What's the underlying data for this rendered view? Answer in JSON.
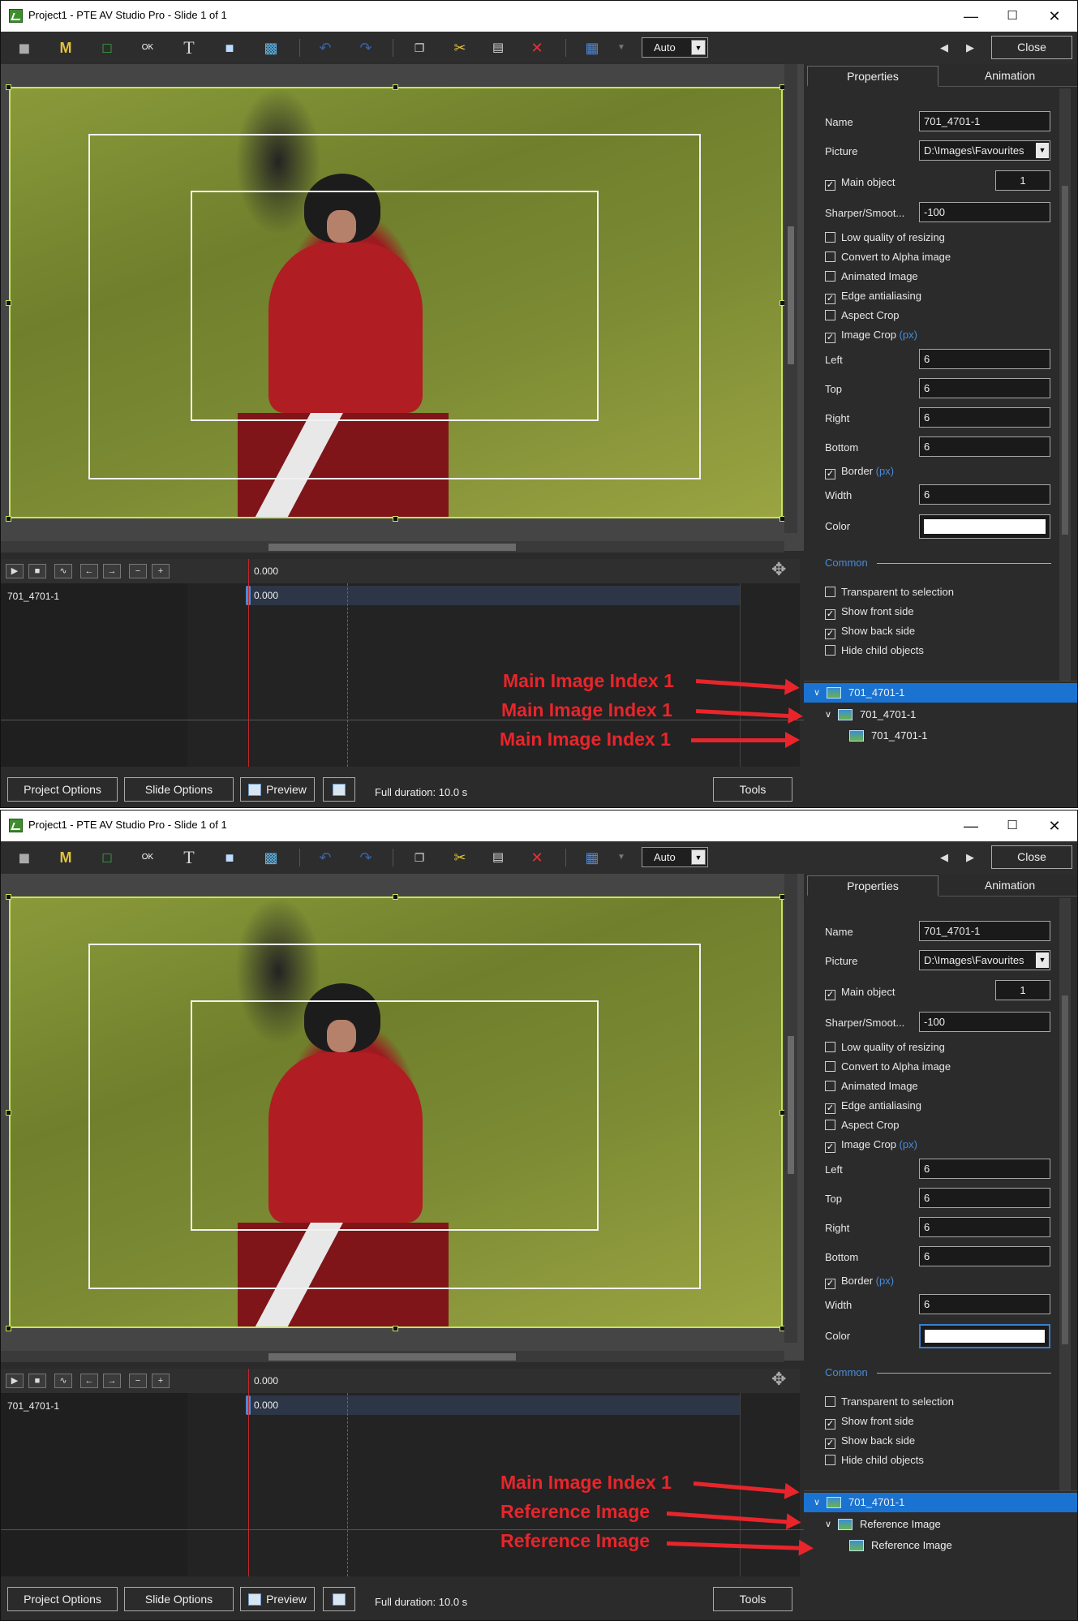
{
  "window": {
    "title": "Project1 - PTE AV Studio Pro - Slide 1 of 1",
    "minimize": "—",
    "maximize": "☐",
    "close": "✕"
  },
  "toolbar": {
    "auto_label": "Auto",
    "close_label": "Close",
    "icons": [
      "camera-icon",
      "mask-icon",
      "frame-icon",
      "button-icon",
      "text-icon",
      "rectangle-icon",
      "image-icon",
      "undo-icon",
      "redo-icon",
      "copy-icon",
      "cut-icon",
      "paste-icon",
      "delete-icon",
      "grid-icon",
      "dropdown-icon"
    ]
  },
  "timeline": {
    "time": "0.000",
    "object_name": "701_4701-1",
    "clip_time": "0.000"
  },
  "properties": {
    "tab_properties": "Properties",
    "tab_animation": "Animation",
    "name_label": "Name",
    "name_value": "701_4701-1",
    "picture_label": "Picture",
    "picture_value": "D:\\Images\\Favourites",
    "main_object_label": "Main object",
    "main_object_value": "1",
    "sharper_label": "Sharper/Smoot...",
    "sharper_value": "-100",
    "low_quality": "Low quality of resizing",
    "convert_alpha": "Convert to Alpha image",
    "animated": "Animated Image",
    "edge": "Edge antialiasing",
    "aspect_crop": "Aspect Crop",
    "image_crop": "Image Crop",
    "px": "(px)",
    "left_label": "Left",
    "left_value": "6",
    "top_label": "Top",
    "top_value": "6",
    "right_label": "Right",
    "right_value": "6",
    "bottom_label": "Bottom",
    "bottom_value": "6",
    "border_label": "Border",
    "width_label": "Width",
    "width_value": "6",
    "color_label": "Color",
    "common_label": "Common",
    "transparent": "Transparent to selection",
    "show_front": "Show front side",
    "show_back": "Show back side",
    "hide_child": "Hide child objects"
  },
  "bottom": {
    "project_options": "Project Options",
    "slide_options": "Slide Options",
    "preview": "Preview",
    "full_duration": "Full duration: 10.0 s",
    "tools": "Tools"
  },
  "panel1": {
    "tree": [
      "701_4701-1",
      "701_4701-1",
      "701_4701-1"
    ],
    "annotations": [
      "Main Image Index 1",
      "Main Image Index 1",
      "Main Image Index 1"
    ]
  },
  "panel2": {
    "tree": [
      "701_4701-1",
      "Reference Image",
      "Reference Image"
    ],
    "annotations": [
      "Main Image Index 1",
      "Reference Image",
      "Reference Image"
    ]
  },
  "colors": {
    "selection_blue": "#1a72d1",
    "annotation_red": "#e8252b",
    "selection_frame": "#c7e55b"
  }
}
